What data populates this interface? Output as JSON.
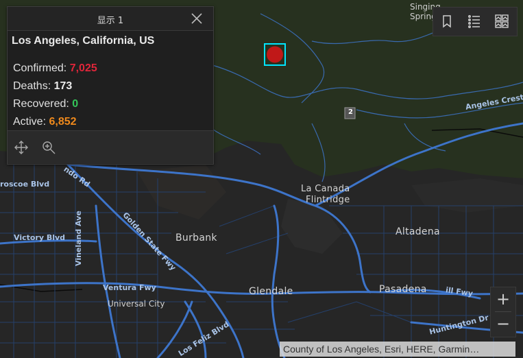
{
  "popup": {
    "title": "显示 1",
    "location": "Los Angeles, California, US",
    "confirmed_label": "Confirmed: ",
    "confirmed_value": "7,025",
    "deaths_label": "Deaths: ",
    "deaths_value": "173",
    "recovered_label": "Recovered: ",
    "recovered_value": "0",
    "active_label": "Active: ",
    "active_value": "6,852",
    "icons": {
      "close": "close-icon",
      "pan": "pan-icon",
      "zoom_to": "zoom-to-icon"
    }
  },
  "toolbar": {
    "icons": [
      "bookmark-icon",
      "list-icon",
      "basemap-gallery-icon"
    ]
  },
  "zoom": {
    "in": "+",
    "out": "−"
  },
  "attribution": "County of Los Angeles, Esri, HERE, Garmin…",
  "map_labels": {
    "singing_springs": "Singing",
    "singing_springs_2": "Spring",
    "angeles_crest": "Angeles Crest",
    "la_canada": "La Canada",
    "flintridge": "Flintridge",
    "altadena": "Altadena",
    "burbank": "Burbank",
    "glendale": "Glendale",
    "pasadena": "Pasadena",
    "universal_city": "Universal City",
    "victory_blvd": "Victory Blvd",
    "vineland_ave": "Vineland Ave",
    "ventura_fwy": "Ventura Fwy",
    "golden_state_fwy": "Golden State Fwy",
    "glenoaks": "ndo Rd",
    "roscoe": "roscoe Blvd",
    "los_feliz": "Los Feliz Blvd",
    "huntington": "Huntington Dr",
    "ill_fwy": "ill Fwy",
    "route_2": "2"
  },
  "colors": {
    "forest": "#27311f",
    "urban": "#262626",
    "highway": "#3d74c9",
    "road": "#25406b",
    "marker": "#c01818",
    "marker_highlight": "#00e5ff"
  }
}
